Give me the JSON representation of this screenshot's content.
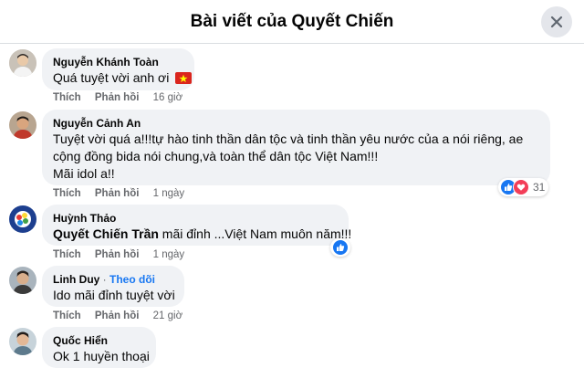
{
  "header": {
    "title": "Bài viết của Quyết Chiến"
  },
  "colors": {
    "like_blue": "#1877f2",
    "love_red": "#f33e58",
    "bubble_bg": "#f0f2f5",
    "meta_gray": "#65676b"
  },
  "comments": [
    {
      "author": "Nguyễn Khánh Toàn",
      "text": "Quá tuyệt vời anh ơi",
      "emoji_icon": "vietnam-flag-icon",
      "actions": {
        "like": "Thích",
        "reply": "Phản hồi",
        "time": "16 giờ"
      }
    },
    {
      "author": "Nguyễn Cảnh An",
      "lines": [
        "Tuyệt vời quá a!!!tự hào tinh thần dân tộc và tinh thần yêu nước của a nói riêng, ae",
        "cộng đồng bida nói chung,và toàn thể dân tộc Việt Nam!!!",
        "Mãi idol a!!"
      ],
      "actions": {
        "like": "Thích",
        "reply": "Phản hồi",
        "time": "1 ngày"
      },
      "reactions": {
        "icons": [
          "like-icon",
          "love-icon"
        ],
        "count": "31"
      }
    },
    {
      "author": "Huỳnh Thảo",
      "mention": "Quyết Chiến Trần",
      "text": " mãi đỉnh ...Việt Nam muôn năm!!!",
      "actions": {
        "like": "Thích",
        "reply": "Phản hồi",
        "time": "1 ngày"
      },
      "reactions": {
        "icons": [
          "like-icon"
        ]
      }
    },
    {
      "author": "Linh Duy",
      "separator": "·",
      "follow": "Theo dõi",
      "text": "Ido mãi đỉnh tuyệt vời",
      "actions": {
        "like": "Thích",
        "reply": "Phản hồi",
        "time": "21 giờ"
      }
    },
    {
      "author": "Quốc Hiển",
      "text": "Ok 1 huyền thoại"
    }
  ]
}
